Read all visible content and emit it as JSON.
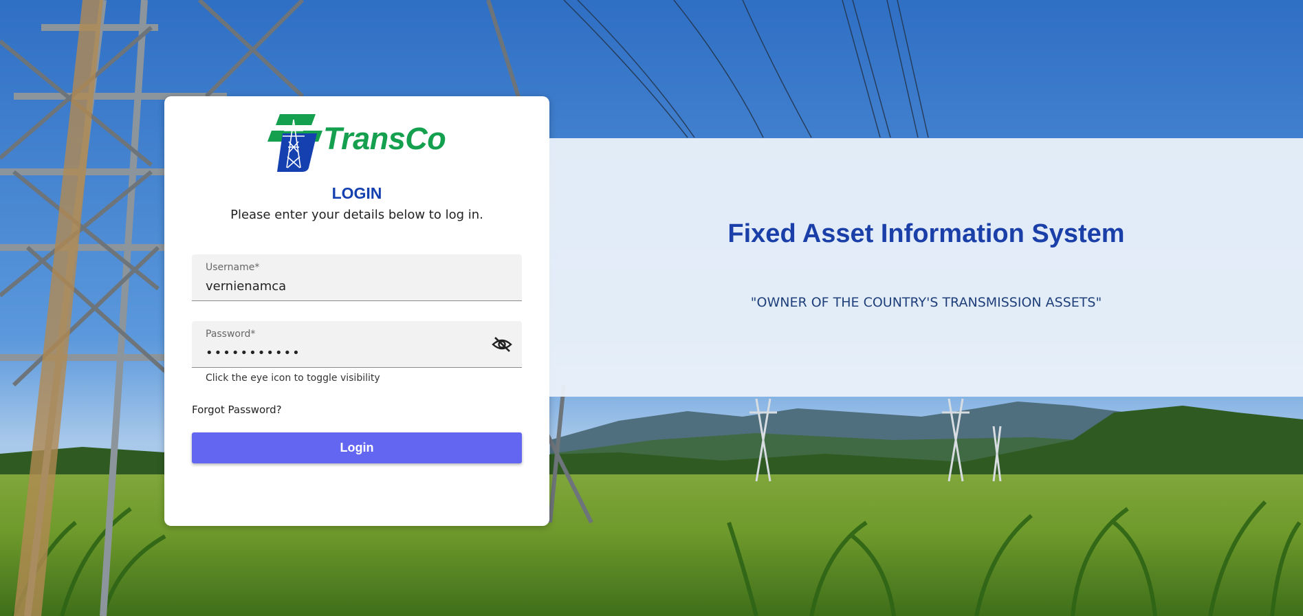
{
  "brand": {
    "logo_text": "TransCo",
    "colors": {
      "green": "#14a04e",
      "blue": "#1540b0"
    }
  },
  "login": {
    "title": "LOGIN",
    "subtitle": "Please enter your details below to log in.",
    "username": {
      "label": "Username*",
      "value": "vernienamca"
    },
    "password": {
      "label": "Password*",
      "value": "hiddenpassw",
      "icon": "eye-off-icon"
    },
    "helper_text": "Click the eye icon to toggle visibility",
    "forgot_label": "Forgot Password?",
    "button_label": "Login",
    "button_color": "#6366f1"
  },
  "info": {
    "title": "Fixed Asset Information System",
    "tagline": "\"OWNER OF THE COUNTRY'S TRANSMISSION ASSETS\""
  }
}
